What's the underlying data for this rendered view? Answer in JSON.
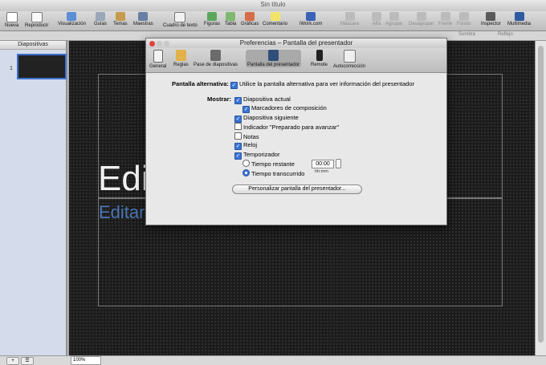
{
  "window": {
    "title": "Sin título"
  },
  "toolbar": {
    "items": [
      {
        "label": "Nueva",
        "icon": "new-icon"
      },
      {
        "label": "Reproducir",
        "icon": "play-icon"
      },
      {
        "label": "Visualización",
        "icon": "view-icon"
      },
      {
        "label": "Guías",
        "icon": "guides-icon"
      },
      {
        "label": "Temas",
        "icon": "themes-icon"
      },
      {
        "label": "Maestras",
        "icon": "masters-icon"
      },
      {
        "label": "Cuadro de texto",
        "icon": "text-box-icon"
      },
      {
        "label": "Figuras",
        "icon": "shapes-icon"
      },
      {
        "label": "Tabla",
        "icon": "table-icon"
      },
      {
        "label": "Gráficas",
        "icon": "charts-icon"
      },
      {
        "label": "Comentario",
        "icon": "comment-icon"
      },
      {
        "label": "iWork.com",
        "icon": "iwork-icon"
      },
      {
        "label": "Máscara",
        "icon": "mask-icon"
      },
      {
        "label": "Alfa",
        "icon": "alpha-icon"
      },
      {
        "label": "Agrupar",
        "icon": "group-icon"
      },
      {
        "label": "Desagrupar",
        "icon": "ungroup-icon"
      },
      {
        "label": "Frente",
        "icon": "front-icon"
      },
      {
        "label": "Fondo",
        "icon": "back-icon"
      },
      {
        "label": "Inspector",
        "icon": "inspector-icon"
      },
      {
        "label": "Multimedia",
        "icon": "media-icon"
      }
    ]
  },
  "format_bar": {
    "sombra": "Sombra",
    "reflejo": "Reflejo"
  },
  "sidebar": {
    "header": "Diapositivas",
    "slide_number": "1"
  },
  "slide": {
    "title": "Edit",
    "subtitle": "Editar"
  },
  "bottom": {
    "zoom": "100%",
    "add": "+",
    "view": "☰"
  },
  "dialog": {
    "title": "Preferencias – Pantalla del presentador",
    "tabs": [
      {
        "label": "General",
        "icon": "general-icon"
      },
      {
        "label": "Reglas",
        "icon": "rulers-icon"
      },
      {
        "label": "Pase de diapositivas",
        "icon": "slideshow-icon"
      },
      {
        "label": "Pantalla del presentador",
        "icon": "presenter-display-icon"
      },
      {
        "label": "Remote",
        "icon": "remote-icon"
      },
      {
        "label": "Autocorrección",
        "icon": "autocorrect-icon"
      }
    ],
    "alt_label": "Pantalla alternativa:",
    "alt_option": "Utilice la pantalla alternativa para ver información del presentador",
    "show_label": "Mostrar:",
    "options": {
      "current_slide": "Diapositiva actual",
      "build_markers": "Marcadores de composición",
      "next_slide": "Diapositiva siguiente",
      "ready_indicator": "Indicador \"Preparado para avanzar\"",
      "notes": "Notas",
      "clock": "Reloj",
      "timer": "Temporizador",
      "time_remaining": "Tiempo restante",
      "time_elapsed": "Tiempo transcurrido"
    },
    "time_value": "00:00",
    "time_format": "hh:mm",
    "customize_button": "Personalizar pantalla del presentador..."
  }
}
